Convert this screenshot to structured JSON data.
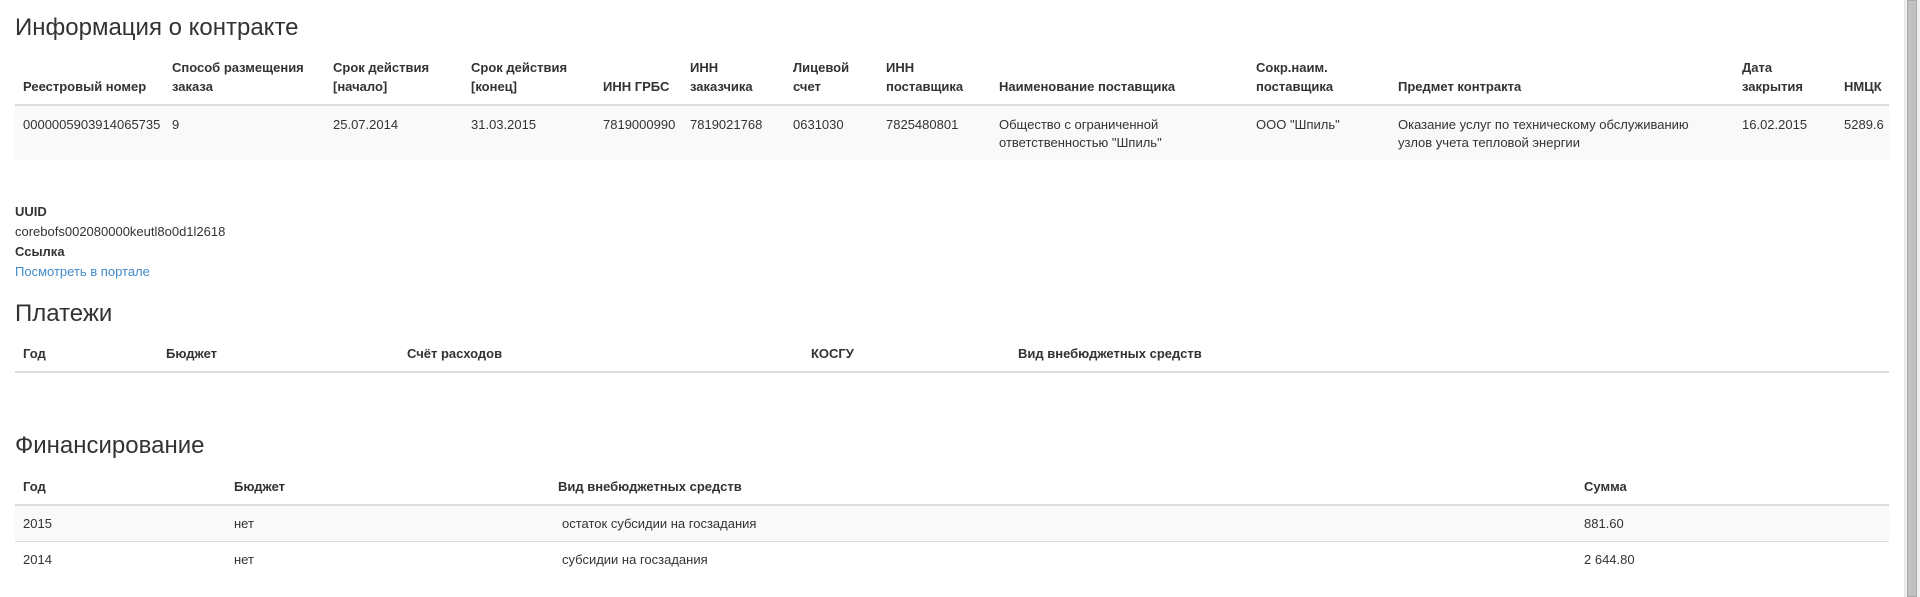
{
  "contract": {
    "title": "Информация о контракте",
    "headers": [
      "Реестровый номер",
      "Способ размещения заказа",
      "Срок действия [начало]",
      "Срок действия [конец]",
      "ИНН ГРБС",
      "ИНН заказчика",
      "Лицевой счет",
      "ИНН поставщика",
      "Наименование поставщика",
      "Сокр.наим. поставщика",
      "Предмет контракта",
      "Дата закрытия",
      "НМЦК"
    ],
    "row": [
      "0000005903914065735",
      "9",
      "25.07.2014",
      "31.03.2015",
      "7819000990",
      "7819021768",
      "0631030",
      "7825480801",
      "Общество с ограниченной ответственностью \"Шпиль\"",
      "ООО \"Шпиль\"",
      "Оказание услуг по техническому обслуживанию узлов учета тепловой энергии",
      "16.02.2015",
      "5289.6"
    ]
  },
  "meta": {
    "uuid_label": "UUID",
    "uuid_value": "corebofs002080000keutl8o0d1l2618",
    "link_label": "Ссылка",
    "link_text": "Посмотреть в портале"
  },
  "payments": {
    "title": "Платежи",
    "headers": [
      "Год",
      "Бюджет",
      "Счёт расходов",
      "КОСГУ",
      "Вид внебюджетных средств"
    ]
  },
  "financing": {
    "title": "Финансирование",
    "headers": [
      "Год",
      "Бюджет",
      "Вид внебюджетных средств",
      "Сумма"
    ],
    "rows": [
      [
        "2015",
        "нет",
        "остаток субсидии на госзадания",
        "881.60"
      ],
      [
        "2014",
        "нет",
        "субсидии на госзадания",
        "2 644.80"
      ]
    ]
  }
}
